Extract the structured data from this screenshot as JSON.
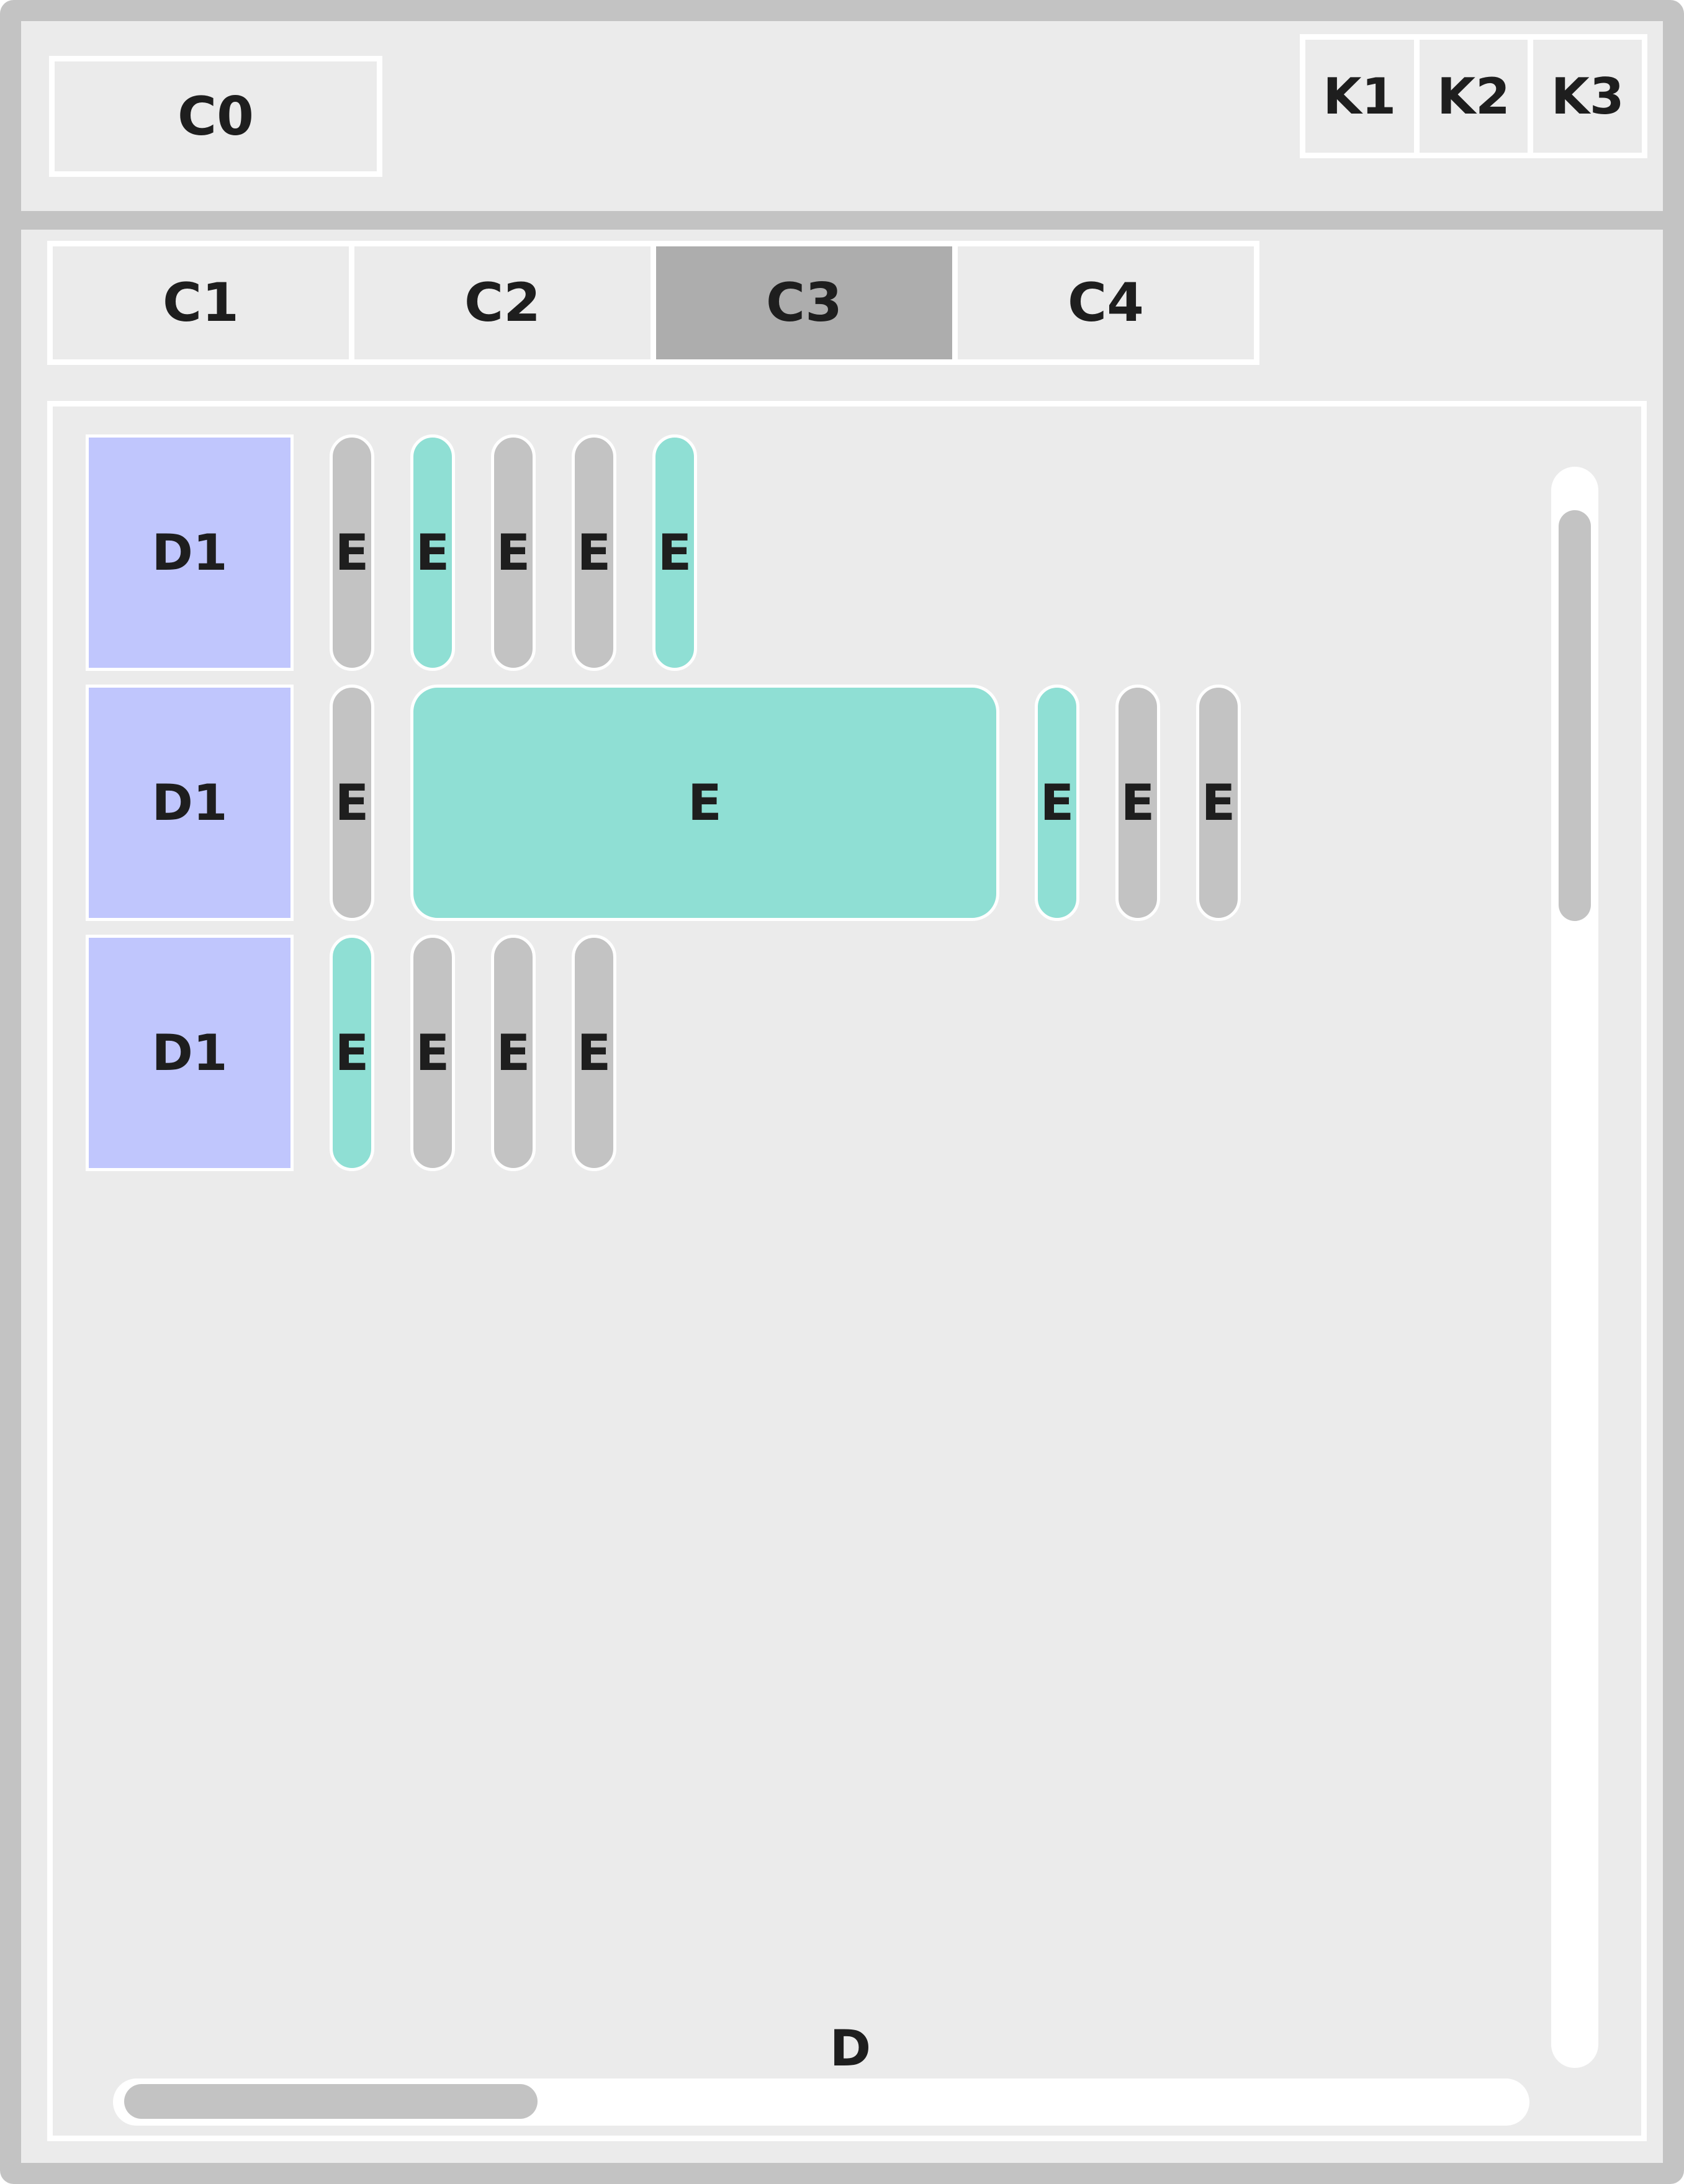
{
  "header": {
    "title_box": "C0",
    "controls": [
      "K1",
      "K2",
      "K3"
    ]
  },
  "tabs": {
    "items": [
      "C1",
      "C2",
      "C3",
      "C4"
    ],
    "active": "C3"
  },
  "panel": {
    "label": "D",
    "rows": [
      {
        "header": "D1",
        "items": [
          {
            "label": "E",
            "color": "gray",
            "size": "narrow"
          },
          {
            "label": "E",
            "color": "teal",
            "size": "narrow"
          },
          {
            "label": "E",
            "color": "gray",
            "size": "narrow"
          },
          {
            "label": "E",
            "color": "gray",
            "size": "narrow"
          },
          {
            "label": "E",
            "color": "teal",
            "size": "narrow"
          }
        ]
      },
      {
        "header": "D1",
        "items": [
          {
            "label": "E",
            "color": "gray",
            "size": "narrow"
          },
          {
            "label": "E",
            "color": "teal",
            "size": "wide"
          },
          {
            "label": "E",
            "color": "teal",
            "size": "narrow"
          },
          {
            "label": "E",
            "color": "gray",
            "size": "narrow"
          },
          {
            "label": "E",
            "color": "gray",
            "size": "narrow"
          }
        ]
      },
      {
        "header": "D1",
        "items": [
          {
            "label": "E",
            "color": "teal",
            "size": "narrow"
          },
          {
            "label": "E",
            "color": "gray",
            "size": "narrow"
          },
          {
            "label": "E",
            "color": "gray",
            "size": "narrow"
          },
          {
            "label": "E",
            "color": "gray",
            "size": "narrow"
          }
        ]
      }
    ]
  },
  "colors": {
    "frame": "#c3c3c3",
    "background": "#ebebeb",
    "border": "#ffffff",
    "active_tab": "#adadad",
    "row_header": "#c0c6fd",
    "teal": "#8fdfd4",
    "gray": "#c3c3c3"
  }
}
